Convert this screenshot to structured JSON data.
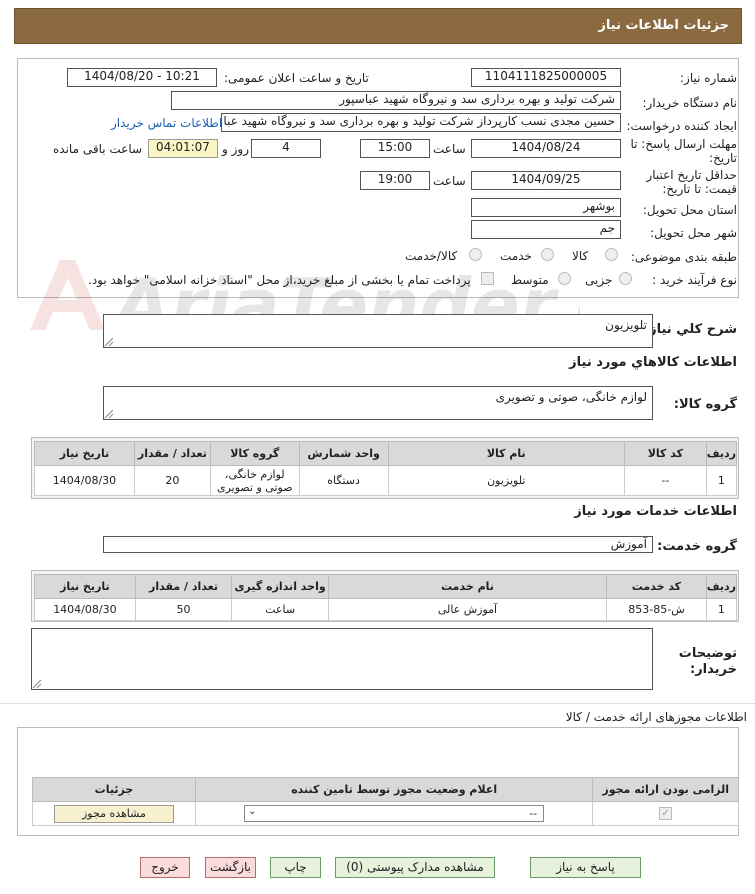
{
  "header": {
    "title": "جزئیات اطلاعات نیاز"
  },
  "form": {
    "need_number_label": "شماره نیاز:",
    "need_number": "1104111825000005",
    "announce_label": "تاریخ و ساعت اعلان عمومی:",
    "announce_value": "1404/08/20 - 10:21",
    "buyer_org_label": "نام دستگاه خریدار:",
    "buyer_org": "شرکت تولید و بهره برداری سد و نیروگاه شهید عباسپور",
    "creator_label": "ایجاد کننده درخواست:",
    "creator": "حسین مجدی نسب کارپرداز  شرکت تولید و بهره برداری سد و نیروگاه شهید عبا",
    "contact_link": "اطلاعات تماس خریدار",
    "deadline_label_1": "مهلت ارسال پاسخ: تا",
    "deadline_label_2": "تاریخ:",
    "deadline_date": "1404/08/24",
    "time_label": "ساعت",
    "deadline_time": "15:00",
    "days_value": "4",
    "day_and": "روز و",
    "remaining_time": "04:01:07",
    "remaining_label": "ساعت باقی مانده",
    "validity_label_1": "حداقل تاریخ اعتبار",
    "validity_label_2": "قیمت: تا تاریخ:",
    "validity_date": "1404/09/25",
    "validity_time": "19:00",
    "province_label": "استان محل تحویل:",
    "province": "بوشهر",
    "city_label": "شهر محل تحویل:",
    "city": "جم",
    "category_label": "طبقه بندی موضوعی:",
    "category_options": [
      "کالا",
      "خدمت",
      "کالا/خدمت"
    ],
    "process_label": "نوع فرآیند خرید :",
    "process_options": [
      "جزیی",
      "متوسط"
    ],
    "payment_note": "پرداخت تمام یا بخشی از مبلغ خرید،از محل \"اسناد خزانه اسلامی\" خواهد بود."
  },
  "summary": {
    "label": "شرح کلي نياز:",
    "value": "تلویزیون"
  },
  "goods": {
    "section_title": "اطلاعات کالاهاي مورد نياز",
    "group_label": "گروه کالا:",
    "group_value": "لوازم خانگی، صوتی و تصویری",
    "columns": [
      "ردیف",
      "کد کالا",
      "نام کالا",
      "واحد شمارش",
      "گروه کالا",
      "تعداد / مقدار",
      "تاریخ نیاز"
    ],
    "rows": [
      [
        "1",
        "--",
        "تلویزیون",
        "دستگاه",
        "لوازم خانگی، صوتی و تصویری",
        "20",
        "1404/08/30"
      ]
    ]
  },
  "services": {
    "section_title": "اطلاعات خدمات مورد نياز",
    "group_label": "گروه خدمت:",
    "group_value": "آموزش",
    "columns": [
      "ردیف",
      "کد خدمت",
      "نام خدمت",
      "واحد اندازه گیری",
      "تعداد / مقدار",
      "تاریخ نیاز"
    ],
    "rows": [
      [
        "1",
        "ش-85-853",
        "آموزش عالی",
        "ساعت",
        "50",
        "1404/08/30"
      ]
    ]
  },
  "buyer_notes": {
    "label_1": "توضیحات",
    "label_2": "خریدار:",
    "value": ""
  },
  "permits": {
    "section_title": "اطلاعات مجوزهای ارائه خدمت / کالا",
    "columns": [
      "الزامی بودن ارائه مجوز",
      "اعلام وضعیت مجوز توسط تامین کننده",
      "جزئیات"
    ],
    "select_value": "--",
    "view_button": "مشاهده مجوز"
  },
  "footer": {
    "reply": "پاسخ به نیاز",
    "attachments": "مشاهده مدارک پیوستی (0)",
    "print": "چاپ",
    "back": "بازگشت",
    "exit": "خروج"
  },
  "watermark": {
    "text": "AriaTender.neT"
  }
}
